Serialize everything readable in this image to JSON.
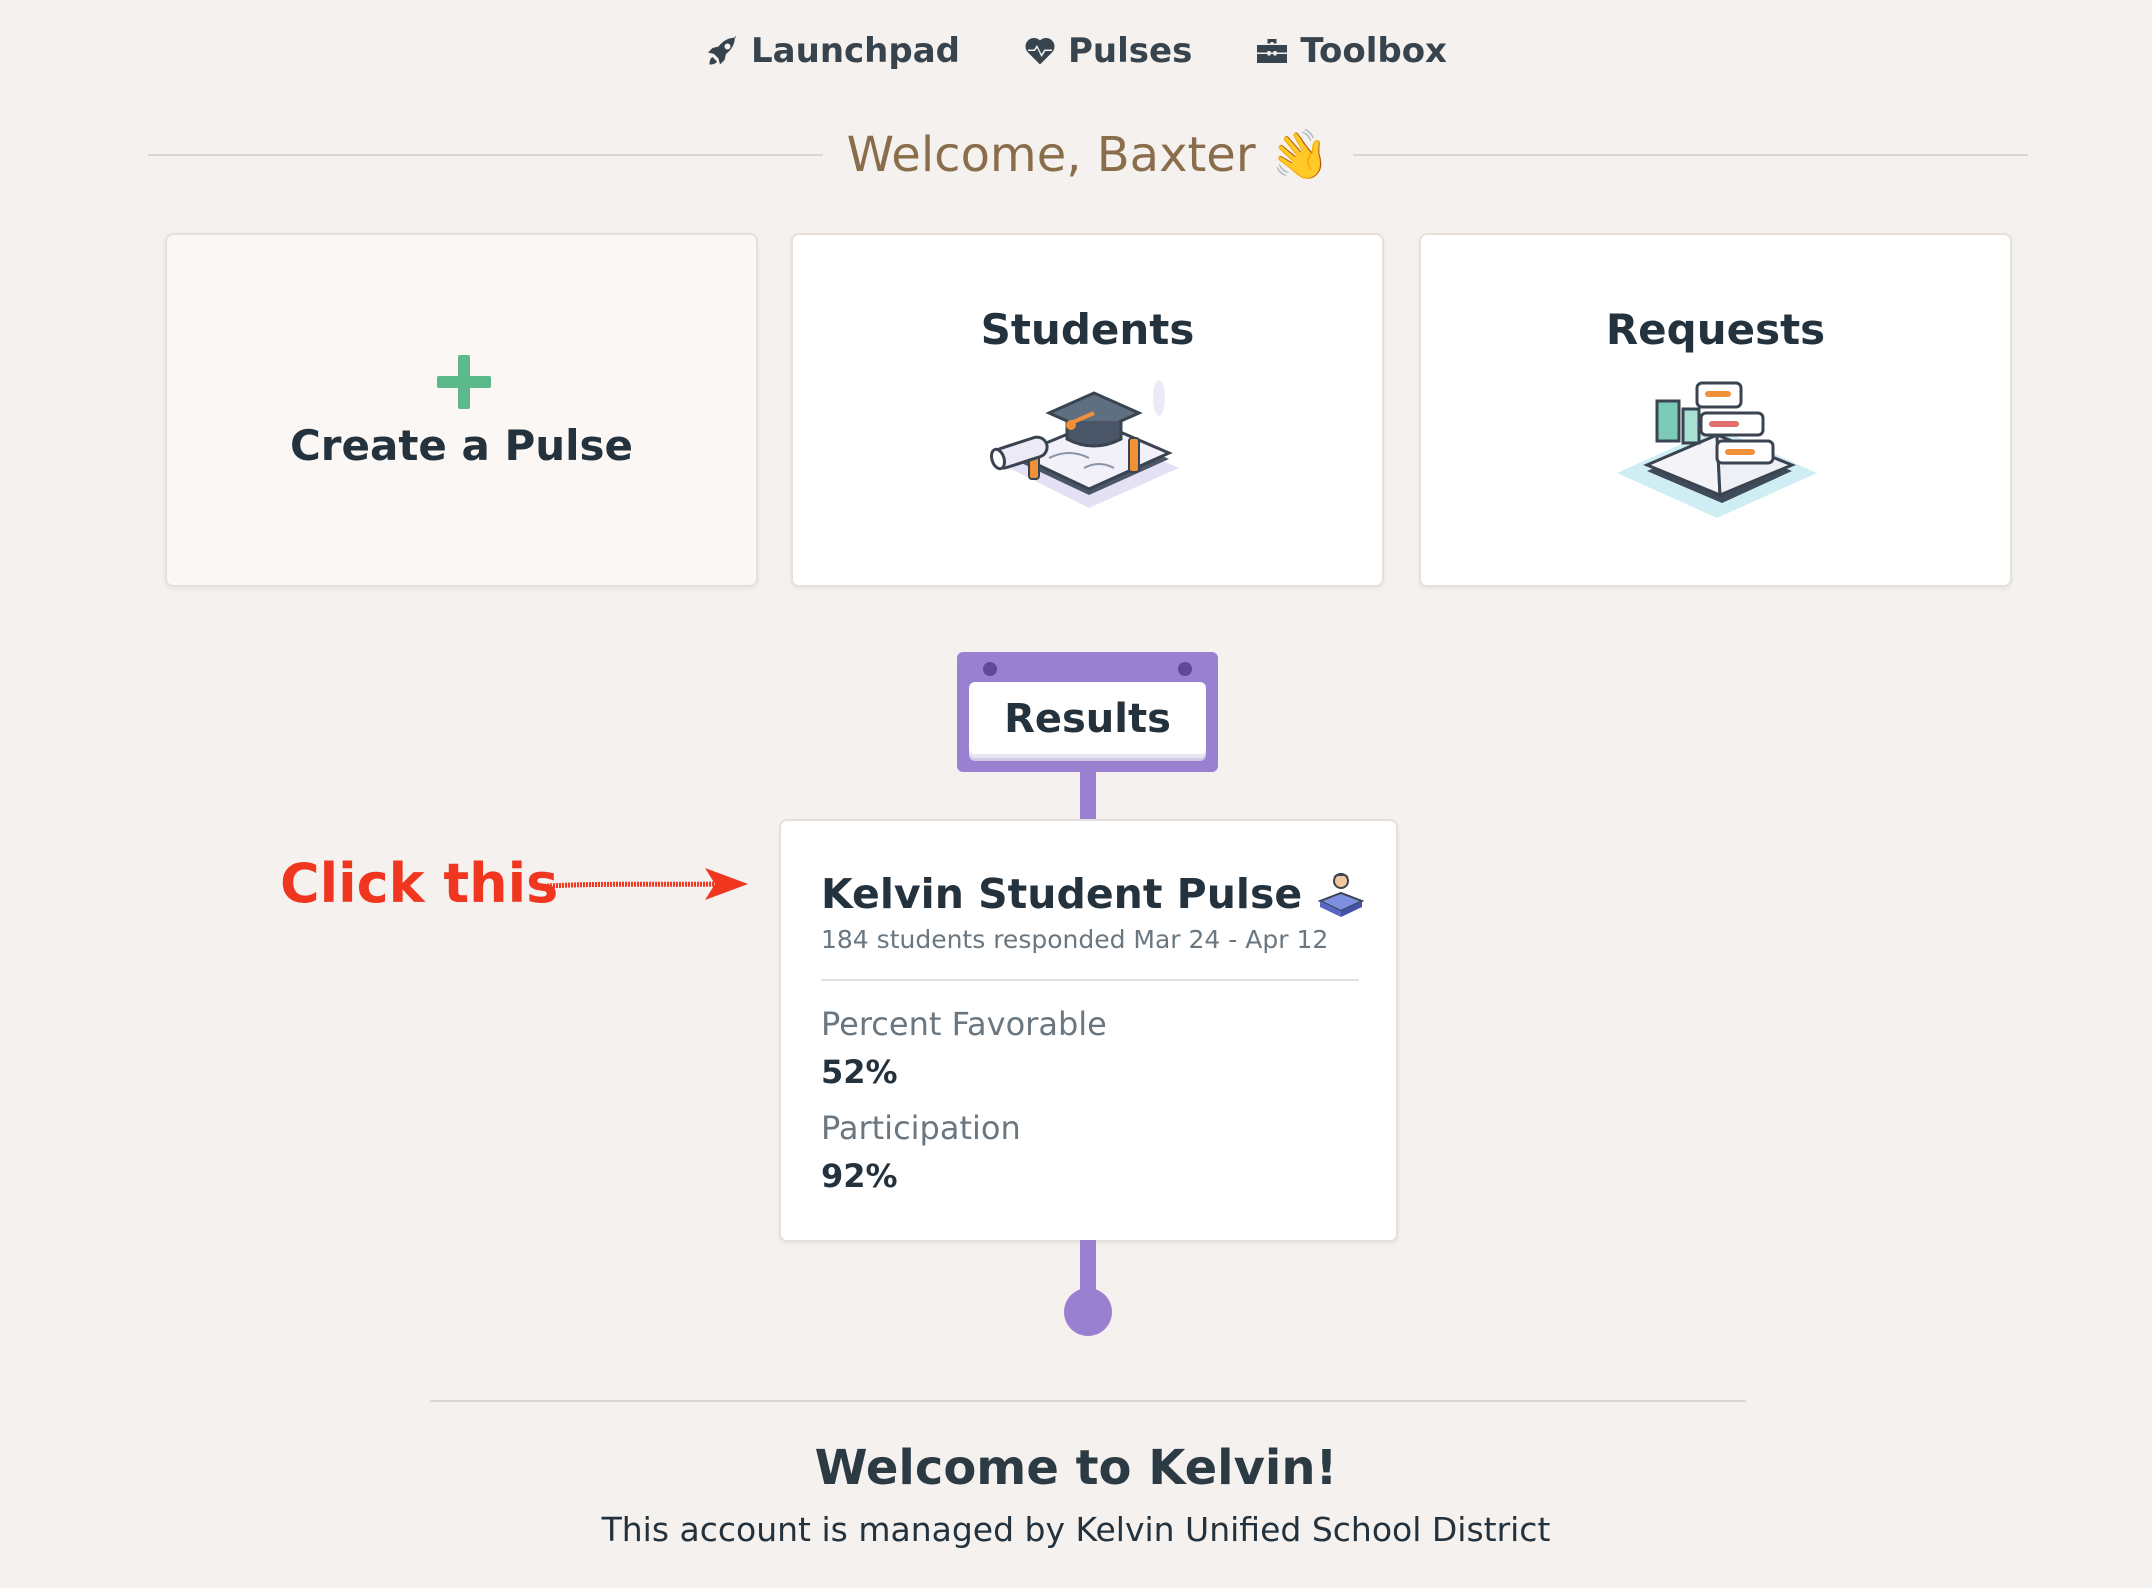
{
  "nav": {
    "items": [
      {
        "label": "Launchpad",
        "icon": "rocket-icon"
      },
      {
        "label": "Pulses",
        "icon": "heartbeat-icon"
      },
      {
        "label": "Toolbox",
        "icon": "toolbox-icon"
      }
    ]
  },
  "welcome": {
    "title": "Welcome, Baxter",
    "emoji": "👋"
  },
  "cards": {
    "create": {
      "label": "Create a Pulse",
      "icon": "plus-icon",
      "icon_color": "#5bb98b"
    },
    "students": {
      "label": "Students",
      "icon": "graduation-illustration"
    },
    "requests": {
      "label": "Requests",
      "icon": "requests-illustration"
    }
  },
  "results": {
    "sign_label": "Results",
    "accent_color": "#9a80d0",
    "pulse": {
      "title": "Kelvin Student Pulse",
      "icon": "student-reading-icon",
      "subtitle": "184 students responded Mar 24 - Apr 12",
      "metrics": [
        {
          "label": "Percent Favorable",
          "value": "52%"
        },
        {
          "label": "Participation",
          "value": "92%"
        }
      ]
    }
  },
  "annotation": {
    "text": "Click this",
    "color": "#f0361f"
  },
  "footer": {
    "title": "Welcome to Kelvin!",
    "subtitle": "This account is managed by Kelvin Unified School District"
  }
}
